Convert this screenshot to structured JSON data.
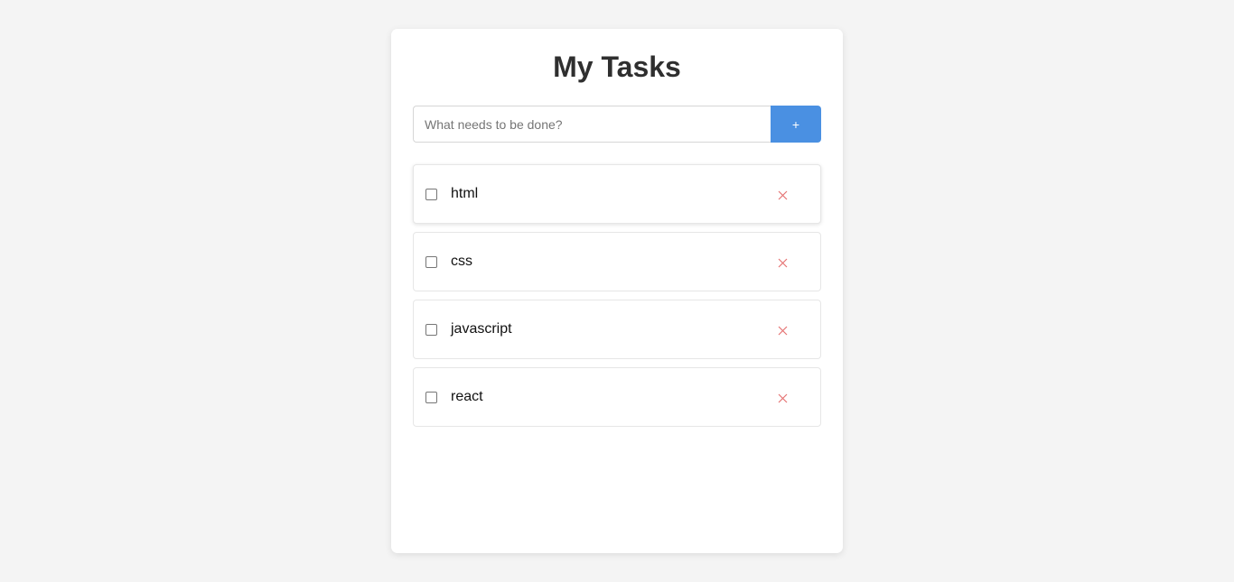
{
  "app": {
    "title": "My Tasks"
  },
  "input": {
    "value": "",
    "placeholder": "What needs to be done?"
  },
  "add_button": {
    "label": "+",
    "color": "#4a90e2"
  },
  "tasks": [
    {
      "label": "html",
      "completed": false,
      "delete_icon": "close-icon"
    },
    {
      "label": "css",
      "completed": false,
      "delete_icon": "close-icon"
    },
    {
      "label": "javascript",
      "completed": false,
      "delete_icon": "close-icon"
    },
    {
      "label": "react",
      "completed": false,
      "delete_icon": "close-icon"
    }
  ],
  "colors": {
    "background": "#f4f4f4",
    "card": "#ffffff",
    "delete": "#e57373"
  }
}
